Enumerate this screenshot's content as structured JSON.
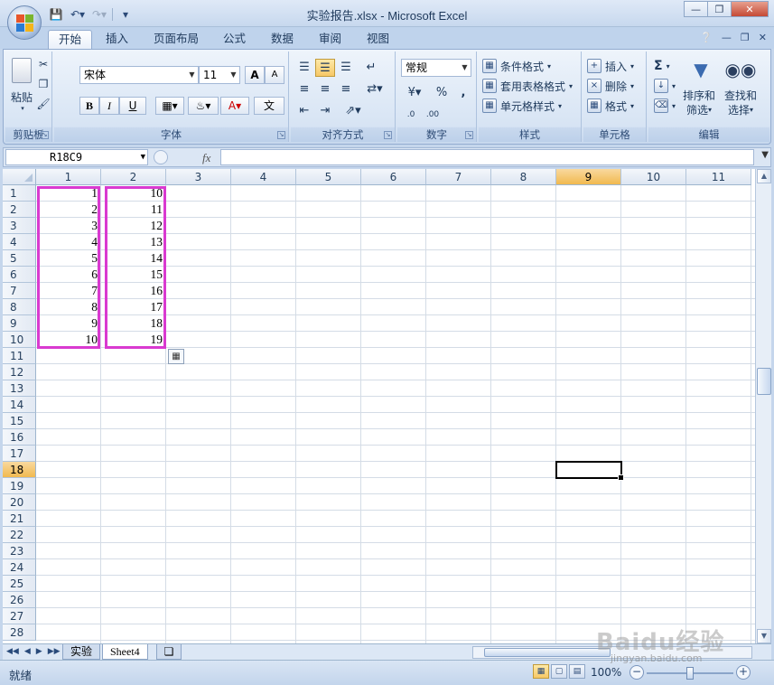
{
  "window": {
    "title": "实验报告.xlsx - Microsoft Excel"
  },
  "colors": {
    "highlight_box": "#d93ad0",
    "selected_header": "#f1b94f"
  },
  "qat": {
    "save_icon": "save-icon",
    "undo_icon": "undo-icon",
    "redo_icon": "redo-icon"
  },
  "tabs": [
    {
      "label": "开始",
      "active": true
    },
    {
      "label": "插入"
    },
    {
      "label": "页面布局"
    },
    {
      "label": "公式"
    },
    {
      "label": "数据"
    },
    {
      "label": "审阅"
    },
    {
      "label": "视图"
    }
  ],
  "ribbon": {
    "clipboard": {
      "paste": "粘贴",
      "label": "剪贴板"
    },
    "font": {
      "name": "宋体",
      "size": "11",
      "label": "字体",
      "bold": "B",
      "italic": "I",
      "underline": "U",
      "grow": "A",
      "shrink": "A",
      "color_a": "A",
      "phonetic": "文"
    },
    "alignment": {
      "label": "对齐方式"
    },
    "number": {
      "format": "常规",
      "percent": "%",
      "comma": ",",
      "label": "数字"
    },
    "styles": {
      "conditional": "条件格式",
      "table": "套用表格格式",
      "cell": "单元格样式",
      "label": "样式"
    },
    "cells": {
      "insert": "插入",
      "delete": "删除",
      "format": "格式",
      "label": "单元格"
    },
    "editing": {
      "sum": "Σ",
      "sort_line1": "排序和",
      "sort_line2": "筛选",
      "find_line1": "查找和",
      "find_line2": "选择",
      "label": "编辑"
    }
  },
  "formula_bar": {
    "name_box": "R18C9",
    "fx": "fx",
    "value": ""
  },
  "grid": {
    "columns": [
      "1",
      "2",
      "3",
      "4",
      "5",
      "6",
      "7",
      "8",
      "9",
      "10",
      "11"
    ],
    "rows": [
      "1",
      "2",
      "3",
      "4",
      "5",
      "6",
      "7",
      "8",
      "9",
      "10",
      "11",
      "12",
      "13",
      "14",
      "15",
      "16",
      "17",
      "18",
      "19",
      "20",
      "21",
      "22",
      "23",
      "24",
      "25",
      "26",
      "27",
      "28"
    ],
    "selected_column": "9",
    "selected_row": "18",
    "col1_values": [
      "1",
      "2",
      "3",
      "4",
      "5",
      "6",
      "7",
      "8",
      "9",
      "10"
    ],
    "col2_values": [
      "10",
      "11",
      "12",
      "13",
      "14",
      "15",
      "16",
      "17",
      "18",
      "19"
    ]
  },
  "sheet_tabs": [
    {
      "label": "实验"
    },
    {
      "label": "Sheet4",
      "active": true
    }
  ],
  "status": {
    "ready": "就绪",
    "zoom": "100%",
    "zoom_level": 100
  },
  "watermark": {
    "brand": "Baidu经验",
    "site": "jingyan.baidu.com"
  }
}
